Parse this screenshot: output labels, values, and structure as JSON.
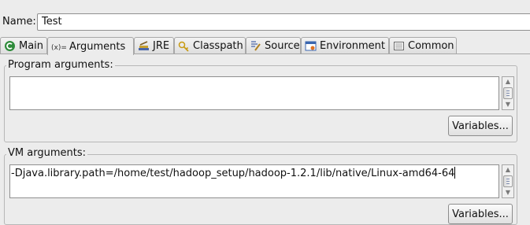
{
  "name_field": {
    "label": "Name:",
    "value": "Test"
  },
  "tabs": [
    {
      "label": "Main",
      "icon": "main-tab-icon",
      "active": false
    },
    {
      "label": "Arguments",
      "icon": "arguments-tab-icon",
      "active": true
    },
    {
      "label": "JRE",
      "icon": "jre-tab-icon",
      "active": false
    },
    {
      "label": "Classpath",
      "icon": "classpath-tab-icon",
      "active": false
    },
    {
      "label": "Source",
      "icon": "source-tab-icon",
      "active": false
    },
    {
      "label": "Environment",
      "icon": "environment-tab-icon",
      "active": false
    },
    {
      "label": "Common",
      "icon": "common-tab-icon",
      "active": false
    }
  ],
  "program_arguments": {
    "title": "Program arguments:",
    "value": "",
    "variables_button": "Variables..."
  },
  "vm_arguments": {
    "title": "VM arguments:",
    "value": "-Djava.library.path=/home/test/hadoop_setup/hadoop-1.2.1/lib/native/Linux-amd64-64",
    "variables_button": "Variables..."
  },
  "colors": {
    "background": "#ececec",
    "main_icon_green": "#2e8b3a",
    "environment_icon_blue": "#3a66b0"
  }
}
